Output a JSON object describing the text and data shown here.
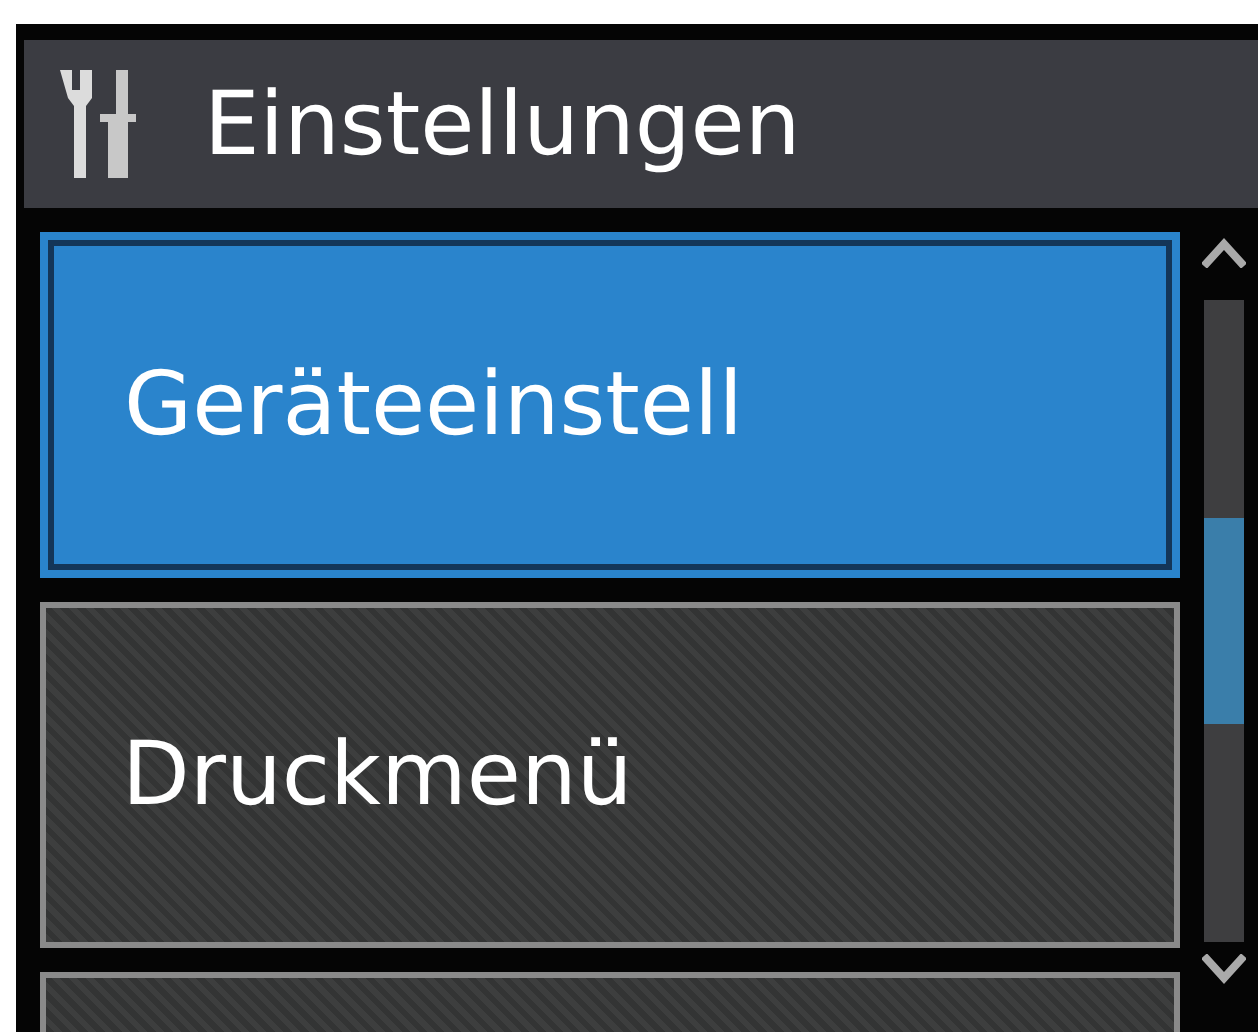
{
  "header": {
    "title": "Einstellungen"
  },
  "items": [
    {
      "label": "Geräteeinstell",
      "selected": true
    },
    {
      "label": "Druckmenü",
      "selected": false
    },
    {
      "selected": false
    }
  ]
}
